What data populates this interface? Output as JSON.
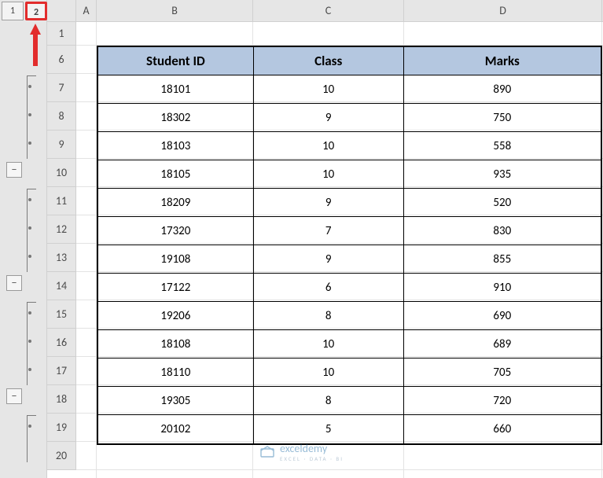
{
  "outline": {
    "level_buttons": [
      "1",
      "2"
    ],
    "highlighted_index": 1,
    "minus_label": "−"
  },
  "columns": [
    "A",
    "B",
    "C",
    "D"
  ],
  "row_numbers": [
    "1",
    "6",
    "7",
    "8",
    "9",
    "10",
    "11",
    "12",
    "13",
    "14",
    "15",
    "16",
    "17",
    "18",
    "19",
    "20"
  ],
  "table": {
    "headers": {
      "b": "Student ID",
      "c": "Class",
      "d": "Marks"
    },
    "rows": [
      {
        "b": "18101",
        "c": "10",
        "d": "890"
      },
      {
        "b": "18302",
        "c": "9",
        "d": "750"
      },
      {
        "b": "18103",
        "c": "10",
        "d": "558"
      },
      {
        "b": "18105",
        "c": "10",
        "d": "935"
      },
      {
        "b": "18209",
        "c": "9",
        "d": "520"
      },
      {
        "b": "17320",
        "c": "7",
        "d": "830"
      },
      {
        "b": "19108",
        "c": "9",
        "d": "855"
      },
      {
        "b": "17122",
        "c": "6",
        "d": "910"
      },
      {
        "b": "19206",
        "c": "8",
        "d": "690"
      },
      {
        "b": "18108",
        "c": "10",
        "d": "689"
      },
      {
        "b": "18110",
        "c": "10",
        "d": "705"
      },
      {
        "b": "19305",
        "c": "8",
        "d": "720"
      },
      {
        "b": "20102",
        "c": "5",
        "d": "660"
      }
    ]
  },
  "watermark": {
    "brand": "exceldemy",
    "tagline": "EXCEL · DATA · BI"
  }
}
